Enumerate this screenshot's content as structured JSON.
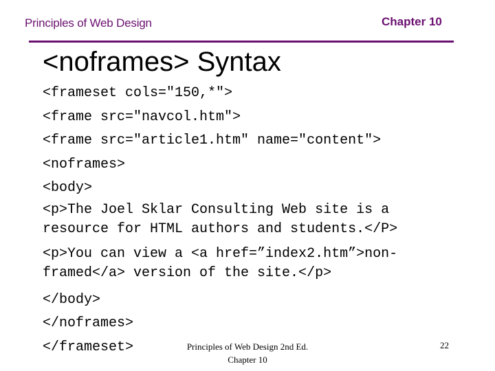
{
  "header": {
    "course_title": "Principles of Web Design",
    "chapter": "Chapter 10",
    "rule_color": "#6b1070",
    "text_color": "#6b1070"
  },
  "slide": {
    "title": "<noframes> Syntax",
    "code_lines": [
      "<frameset cols=\"150,*\">",
      "<frame src=\"navcol.htm\">",
      "<frame src=\"article1.htm\" name=\"content\">",
      "<noframes>",
      "<body>",
      "<p>The Joel Sklar Consulting Web site is a",
      "resource for HTML authors and students.</P>",
      "<p>You can view a <a href=”index2.htm”>non-",
      "framed</a> version of the site.</p>",
      "</body>",
      "</noframes>",
      "</frameset>"
    ]
  },
  "footer": {
    "book_title": "Principles of Web Design 2nd Ed.",
    "chapter": "Chapter 10",
    "page_number": "22"
  }
}
